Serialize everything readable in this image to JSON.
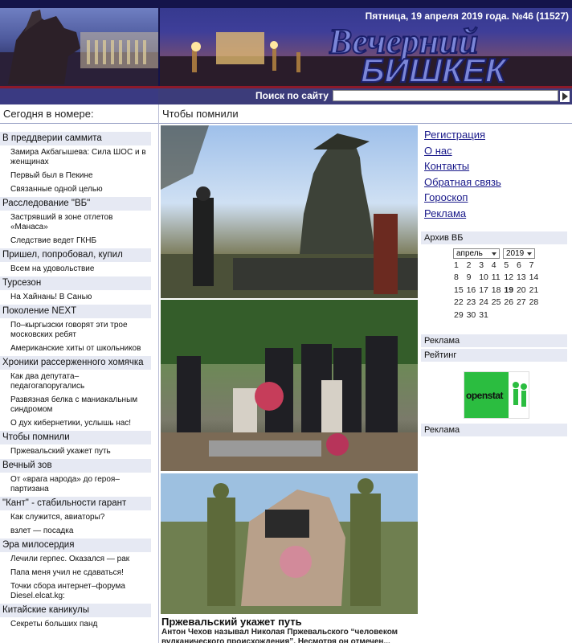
{
  "header": {
    "date_line": "Пятница, 19 апреля 2019 года. №46 (11527)",
    "logo_line1": "Вечерний",
    "logo_line2": "БИШКЕК",
    "search_label": "Поиск по сайту"
  },
  "left": {
    "heading": "Сегодня в номере:",
    "sections": [
      {
        "title": "В преддверии саммита",
        "items": [
          "Замира Акбагышева: Сила ШОС и в женщинах",
          "Первый был в Пекине",
          "Связанные одной целью"
        ]
      },
      {
        "title": "Расследование \"ВБ\"",
        "items": [
          "Застрявший в зоне отлетов «Манаса»",
          "Следствие ведет ГКНБ"
        ]
      },
      {
        "title": "Пришел, попробовал, купил",
        "items": [
          "Всем на удовольствие"
        ]
      },
      {
        "title": "Турсезон",
        "items": [
          "На Хайнань! В Санью"
        ]
      },
      {
        "title": "Поколение NEXT",
        "items": [
          "По–кыргызски говорят эти трое московских ребят",
          "Американские хиты от школьников"
        ]
      },
      {
        "title": "Хроники рассерженного хомячка",
        "items": [
          "Как два депутата–педагогапоругались",
          "Развязная белка с маниакальным синдромом",
          "О дух кибернетики, услышь нас!"
        ]
      },
      {
        "title": "Чтобы помнили",
        "items": [
          "Пржевальский укажет путь"
        ]
      },
      {
        "title": "Вечный зов",
        "items": [
          "От «врага народа» до героя–партизана"
        ]
      },
      {
        "title": "\"Кант\" - стабильности гарант",
        "items": [
          "Как служится, авиаторы?",
          "взлет — посадка"
        ]
      },
      {
        "title": "Эра милосердия",
        "items": [
          "Лечили герпес. Оказался — рак",
          "Папа меня учил не сдаваться!",
          "Точки сбора интернет–форума Diesel.elcat.kg:"
        ]
      },
      {
        "title": "Китайские каникулы",
        "items": [
          "Секреты больших панд"
        ]
      }
    ]
  },
  "center": {
    "section_title": "Чтобы помнили",
    "article_title": "Пржевальский укажет путь",
    "article_lead": "Антон Чехов называл Николая Пржевальского “человеком вулканического происхождения”. Несмотря он отмечен..."
  },
  "right": {
    "links": [
      "Регистрация",
      "О нас",
      "Контакты",
      "Обратная связь",
      "Гороскоп",
      "Реклама"
    ],
    "archive_heading": "Архив ВБ",
    "archive_month": "апрель",
    "archive_year": "2019",
    "calendar_rows": [
      [
        "1",
        "2",
        "3",
        "4",
        "5",
        "6",
        "7"
      ],
      [
        "8",
        "9",
        "10",
        "11",
        "12",
        "13",
        "14"
      ],
      [
        "15",
        "16",
        "17",
        "18",
        "19",
        "20",
        "21"
      ],
      [
        "22",
        "23",
        "24",
        "25",
        "26",
        "27",
        "28"
      ],
      [
        "29",
        "30",
        "31"
      ]
    ],
    "reklama1": "Реклама",
    "rating_heading": "Рейтинг",
    "openstat_label": "openstat",
    "reklama2": "Реклама"
  }
}
